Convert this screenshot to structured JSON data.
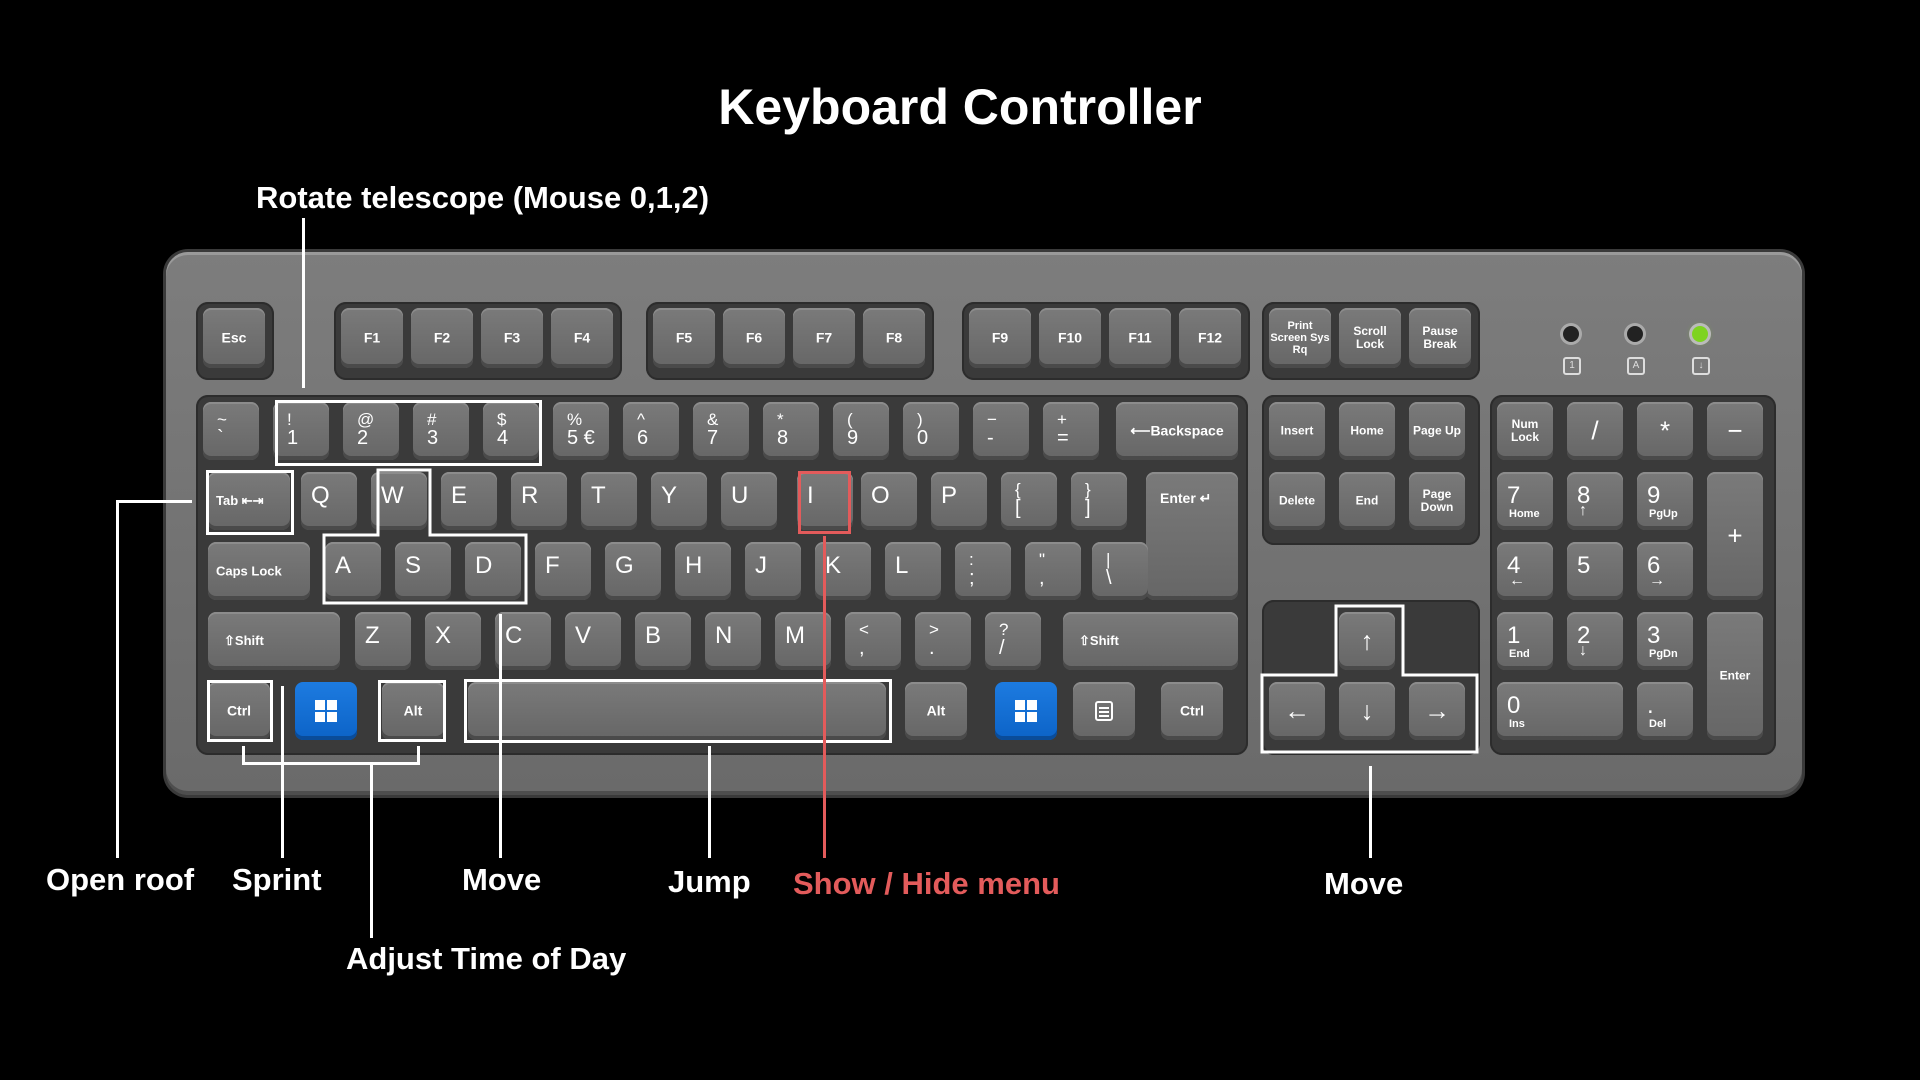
{
  "title": "Keyboard Controller",
  "labels": {
    "rotate": "Rotate telescope (Mouse 0,1,2)",
    "open_roof": "Open roof",
    "sprint": "Sprint",
    "move_left": "Move",
    "jump": "Jump",
    "menu": "Show / Hide menu",
    "move_right": "Move",
    "time_of_day": "Adjust Time of Day"
  },
  "keys": {
    "esc": "Esc",
    "f": [
      "F1",
      "F2",
      "F3",
      "F4",
      "F5",
      "F6",
      "F7",
      "F8",
      "F9",
      "F10",
      "F11",
      "F12"
    ],
    "print": "Print Screen Sys Rq",
    "scroll": "Scroll Lock",
    "pause_top": "Pause",
    "pause_bottom": "Break",
    "num_top": [
      "~",
      "!",
      "@",
      "#",
      "$",
      "%",
      "^",
      "&",
      "*",
      "(",
      ")",
      "−",
      "+"
    ],
    "num_bottom": [
      "`",
      "1",
      "2",
      "3",
      "4",
      "5 €",
      "6",
      "7",
      "8",
      "9",
      "0",
      "-",
      "="
    ],
    "backspace": "⟵Backspace",
    "tab": "Tab ⇤⇥",
    "row_q": [
      "Q",
      "W",
      "E",
      "R",
      "T",
      "Y",
      "U",
      "I",
      "O",
      "P"
    ],
    "bracket_top": [
      "{",
      "}"
    ],
    "bracket_bottom": [
      "[",
      "]"
    ],
    "enter": "Enter ↵",
    "caps": "Caps Lock",
    "row_a": [
      "A",
      "S",
      "D",
      "F",
      "G",
      "H",
      "J",
      "K",
      "L"
    ],
    "semi_top": [
      ":",
      "\"",
      "|"
    ],
    "semi_bottom": [
      ";",
      ",",
      "\\"
    ],
    "shift": "⇧Shift",
    "row_z": [
      "Z",
      "X",
      "C",
      "V",
      "B",
      "N",
      "M"
    ],
    "punct_top": [
      "<",
      ">",
      "?"
    ],
    "punct_bottom": [
      ",",
      ".",
      "/"
    ],
    "ctrl": "Ctrl",
    "alt": "Alt",
    "insert": "Insert",
    "home": "Home",
    "page_up": "Page Up",
    "delete": "Delete",
    "end": "End",
    "page_down": "Page Down",
    "arrows": [
      "↑",
      "←",
      "↓",
      "→"
    ],
    "num_lock": "Num Lock",
    "np_div": "/",
    "np_mul": "*",
    "np_sub": "−",
    "np_add": "+",
    "np_enter": "Enter",
    "np7": [
      "7",
      "Home"
    ],
    "np8": [
      "8",
      "↑"
    ],
    "np9": [
      "9",
      "PgUp"
    ],
    "np4": [
      "4",
      "←"
    ],
    "np5": [
      "5",
      ""
    ],
    "np6": [
      "6",
      "→"
    ],
    "np1": [
      "1",
      "End"
    ],
    "np2": [
      "2",
      "↓"
    ],
    "np3": [
      "3",
      "PgDn"
    ],
    "np0": [
      "0",
      "Ins"
    ],
    "npdot": [
      ".",
      "Del"
    ]
  },
  "leds": [
    "Num lock",
    "Caps lock",
    "Scroll lock"
  ],
  "colors": {
    "highlight": "#ffffff",
    "menu_highlight": "#e35b5b",
    "win_key": "#1d7be0"
  }
}
